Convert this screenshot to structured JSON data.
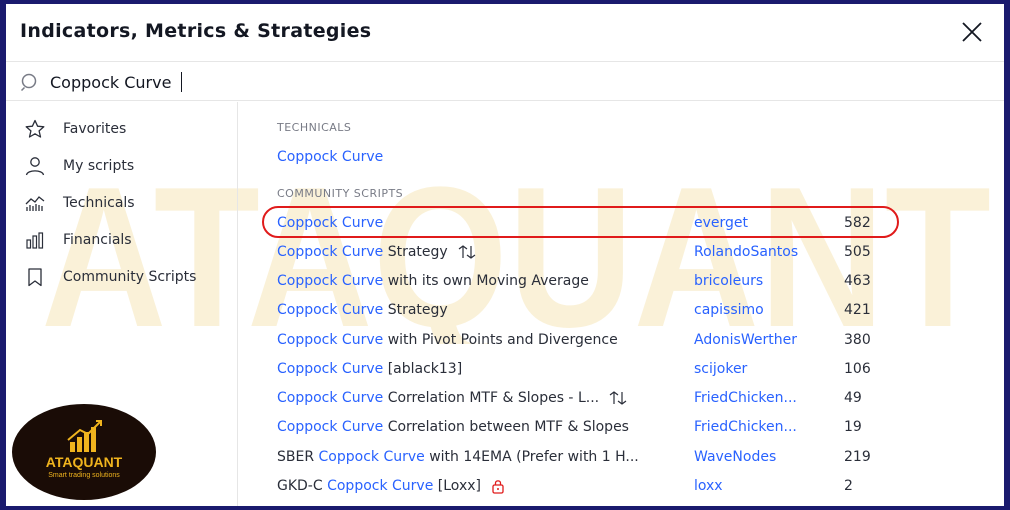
{
  "dialog": {
    "title": "Indicators, Metrics & Strategies"
  },
  "search": {
    "value": "Coppock Curve"
  },
  "sidebar": {
    "items": [
      {
        "label": "Favorites",
        "icon": "star-icon"
      },
      {
        "label": "My scripts",
        "icon": "user-icon"
      },
      {
        "label": "Technicals",
        "icon": "technicals-icon"
      },
      {
        "label": "Financials",
        "icon": "bar-chart-icon"
      },
      {
        "label": "Community Scripts",
        "icon": "bookmark-icon"
      }
    ]
  },
  "sections": {
    "technicals": "TECHNICALS",
    "community": "COMMUNITY SCRIPTS"
  },
  "technicals": [
    {
      "prefix": "",
      "highlight": "Coppock Curve",
      "suffix": ""
    }
  ],
  "community": [
    {
      "prefix": "",
      "highlight": "Coppock Curve",
      "suffix": "",
      "author": "everget",
      "count": "582",
      "badge": ""
    },
    {
      "prefix": "",
      "highlight": "Coppock Curve",
      "suffix": " Strategy",
      "author": "RolandoSantos",
      "count": "505",
      "badge": "strategy-icon"
    },
    {
      "prefix": "",
      "highlight": "Coppock Curve",
      "suffix": " with its own Moving Average",
      "author": "bricoleurs",
      "count": "463",
      "badge": ""
    },
    {
      "prefix": "",
      "highlight": "Coppock Curve",
      "suffix": " Strategy",
      "author": "capissimo",
      "count": "421",
      "badge": ""
    },
    {
      "prefix": "",
      "highlight": "Coppock Curve",
      "suffix": " with Pivot Points and Divergence",
      "author": "AdonisWerther",
      "count": "380",
      "badge": ""
    },
    {
      "prefix": "",
      "highlight": "Coppock Curve",
      "suffix": " [ablack13]",
      "author": "scijoker",
      "count": "106",
      "badge": ""
    },
    {
      "prefix": "",
      "highlight": "Coppock Curve",
      "suffix": " Correlation MTF & Slopes - L...",
      "author": "FriedChicken...",
      "count": "49",
      "badge": "strategy-icon"
    },
    {
      "prefix": "",
      "highlight": "Coppock Curve",
      "suffix": " Correlation between MTF & Slopes",
      "author": "FriedChicken...",
      "count": "19",
      "badge": ""
    },
    {
      "prefix": "SBER ",
      "highlight": "Coppock Curve",
      "suffix": " with 14EMA (Prefer with 1 H...",
      "author": "WaveNodes",
      "count": "219",
      "badge": ""
    },
    {
      "prefix": "GKD-C ",
      "highlight": "Coppock Curve",
      "suffix": " [Loxx]",
      "author": "loxx",
      "count": "2",
      "badge": "lock-icon"
    }
  ],
  "watermark": {
    "text": "ATAQUANT"
  },
  "logo": {
    "name": "ATAQUANT",
    "tagline": "Smart trading solutions"
  },
  "colors": {
    "accent": "#2962ff",
    "highlight_ring": "#e01b1b",
    "frame": "#1a1a6e",
    "watermark": "#f5e6b8",
    "logo_gold": "#f0b41e"
  }
}
